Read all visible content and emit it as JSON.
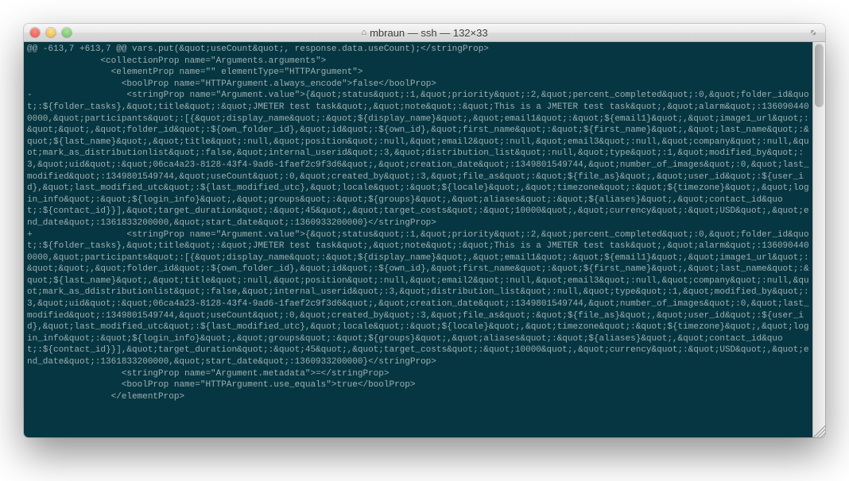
{
  "window": {
    "title": "mbraun — ssh — 132×33"
  },
  "terminal": {
    "lines": [
      "@@ -613,7 +613,7 @@ vars.put(&quot;useCount&quot;, response.data.useCount);</stringProp>",
      "              <collectionProp name=\"Arguments.arguments\">",
      "                <elementProp name=\"\" elementType=\"HTTPArgument\">",
      "                  <boolProp name=\"HTTPArgument.always_encode\">false</boolProp>",
      "-                  <stringProp name=\"Argument.value\">{&quot;status&quot;:1,&quot;priority&quot;:2,&quot;percent_completed&quot;:0,&quot;folder_id&quot;:${folder_tasks},&quot;title&quot;:&quot;JMETER test task&quot;,&quot;note&quot;:&quot;This is a JMETER test task&quot;,&quot;alarm&quot;:1360904400000,&quot;participants&quot;:[{&quot;display_name&quot;:&quot;${display_name}&quot;,&quot;email1&quot;:&quot;${email1}&quot;,&quot;image1_url&quot;:&quot;&quot;,&quot;folder_id&quot;:${own_folder_id},&quot;id&quot;:${own_id},&quot;first_name&quot;:&quot;${first_name}&quot;,&quot;last_name&quot;:&quot;${last_name}&quot;,&quot;title&quot;:null,&quot;position&quot;:null,&quot;email2&quot;:null,&quot;email3&quot;:null,&quot;company&quot;:null,&quot;mark_as_distributionlist&quot;:false,&quot;internal_userid&quot;:3,&quot;distribution_list&quot;:null,&quot;type&quot;:1,&quot;modified_by&quot;:3,&quot;uid&quot;:&quot;06ca4a23-8128-43f4-9ad6-1faef2c9f3d6&quot;,&quot;creation_date&quot;:1349801549744,&quot;number_of_images&quot;:0,&quot;last_modified&quot;:1349801549744,&quot;useCount&quot;:0,&quot;created_by&quot;:3,&quot;file_as&quot;:&quot;${file_as}&quot;,&quot;user_id&quot;:${user_id},&quot;last_modified_utc&quot;:${last_modified_utc},&quot;locale&quot;:&quot;${locale}&quot;,&quot;timezone&quot;:&quot;${timezone}&quot;,&quot;login_info&quot;:&quot;${login_info}&quot;,&quot;groups&quot;:&quot;${groups}&quot;,&quot;aliases&quot;:&quot;${aliases}&quot;,&quot;contact_id&quot;:${contact_id}}],&quot;target_duration&quot;:&quot;45&quot;,&quot;target_costs&quot;:&quot;10000&quot;,&quot;currency&quot;:&quot;USD&quot;,&quot;end_date&quot;:1361833200000,&quot;start_date&quot;:1360933200000}</stringProp>",
      "+                  <stringProp name=\"Argument.value\">{&quot;status&quot;:1,&quot;priority&quot;:2,&quot;percent_completed&quot;:0,&quot;folder_id&quot;:${folder_tasks},&quot;title&quot;:&quot;JMETER test task&quot;,&quot;note&quot;:&quot;This is a JMETER test task&quot;,&quot;alarm&quot;:1360904400000,&quot;participants&quot;:[{&quot;display_name&quot;:&quot;${display_name}&quot;,&quot;email1&quot;:&quot;${email1}&quot;,&quot;image1_url&quot;:&quot;&quot;,&quot;folder_id&quot;:${own_folder_id},&quot;id&quot;:${own_id},&quot;first_name&quot;:&quot;${first_name}&quot;,&quot;last_name&quot;:&quot;${last_name}&quot;,&quot;title&quot;:null,&quot;position&quot;:null,&quot;email2&quot;:null,&quot;email3&quot;:null,&quot;company&quot;:null,&quot;mark_as_ddistributionlist&quot;:false,&quot;internal_userid&quot;:3,&quot;distribution_list&quot;:null,&quot;type&quot;:1,&quot;modified_by&quot;:3,&quot;uid&quot;:&quot;06ca4a23-8128-43f4-9ad6-1faef2c9f3d6&quot;,&quot;creation_date&quot;:1349801549744,&quot;number_of_images&quot;:0,&quot;last_modified&quot;:1349801549744,&quot;useCount&quot;:0,&quot;created_by&quot;:3,&quot;file_as&quot;:&quot;${file_as}&quot;,&quot;user_id&quot;:${user_id},&quot;last_modified_utc&quot;:${last_modified_utc},&quot;locale&quot;:&quot;${locale}&quot;,&quot;timezone&quot;:&quot;${timezone}&quot;,&quot;login_info&quot;:&quot;${login_info}&quot;,&quot;groups&quot;:&quot;${groups}&quot;,&quot;aliases&quot;:&quot;${aliases}&quot;,&quot;contact_id&quot;:${contact_id}}],&quot;target_duration&quot;:&quot;45&quot;,&quot;target_costs&quot;:&quot;10000&quot;,&quot;currency&quot;:&quot;USD&quot;,&quot;end_date&quot;:1361833200000,&quot;start_date&quot;:1360933200000}</stringProp>",
      "                  <stringProp name=\"Argument.metadata\">=</stringProp>",
      "                  <boolProp name=\"HTTPArgument.use_equals\">true</boolProp>",
      "                </elementProp>"
    ]
  }
}
